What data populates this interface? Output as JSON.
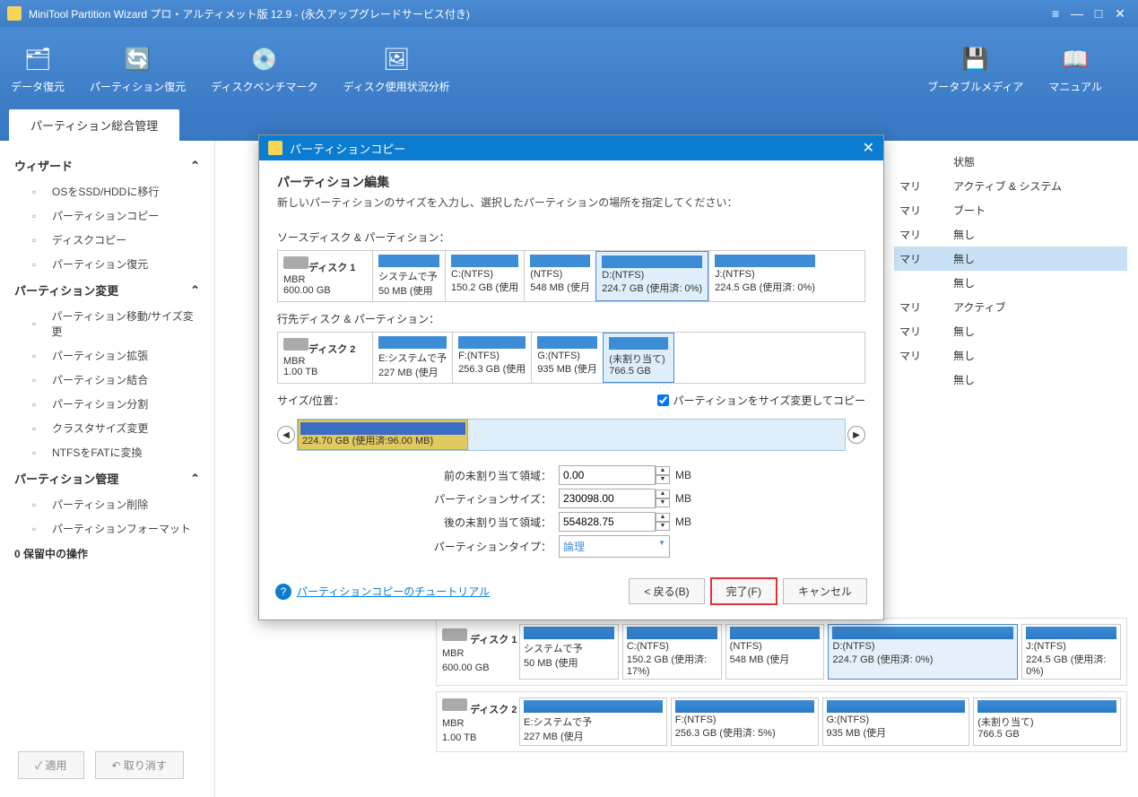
{
  "title": "MiniTool Partition Wizard プロ・アルティメット版 12.9 - (永久アップグレードサービス付き)",
  "ribbon": {
    "items": [
      {
        "label": "データ復元"
      },
      {
        "label": "パーティション復元"
      },
      {
        "label": "ディスクベンチマーク"
      },
      {
        "label": "ディスク使用状況分析"
      }
    ],
    "right": [
      {
        "label": "ブータブルメディア"
      },
      {
        "label": "マニュアル"
      }
    ]
  },
  "tab": "パーティション総合管理",
  "sidebar": {
    "groups": [
      {
        "header": "ウィザード",
        "items": [
          "OSをSSD/HDDに移行",
          "パーティションコピー",
          "ディスクコピー",
          "パーティション復元"
        ]
      },
      {
        "header": "パーティション変更",
        "items": [
          "パーティション移動/サイズ変更",
          "パーティション拡張",
          "パーティション結合",
          "パーティション分割",
          "クラスタサイズ変更",
          "NTFSをFATに変換"
        ]
      },
      {
        "header": "パーティション管理",
        "items": [
          "パーティション削除",
          "パーティションフォーマット"
        ]
      }
    ],
    "pending": "0 保留中の操作",
    "apply": "✓ 適用",
    "undo": "↶ 取り消す"
  },
  "list": {
    "header_status": "状態",
    "rows": [
      {
        "type": "マリ",
        "status": "アクティブ & システム"
      },
      {
        "type": "マリ",
        "status": "ブート"
      },
      {
        "type": "マリ",
        "status": "無し"
      },
      {
        "type": "マリ",
        "status": "無し",
        "sel": true
      },
      {
        "type": "",
        "status": "無し"
      },
      {
        "type": "マリ",
        "status": "アクティブ"
      },
      {
        "type": "マリ",
        "status": "無し"
      },
      {
        "type": "マリ",
        "status": "無し"
      },
      {
        "type": "",
        "status": "無し"
      }
    ]
  },
  "dialog": {
    "title": "パーティションコピー",
    "heading": "パーティション編集",
    "desc": "新しいパーティションのサイズを入力し、選択したパーティションの場所を指定してください：",
    "src_label": "ソースディスク & パーティション：",
    "dst_label": "行先ディスク & パーティション：",
    "disk1": {
      "name": "ディスク 1",
      "type": "MBR",
      "size": "600.00 GB",
      "parts": [
        {
          "name": "システムで予",
          "detail": "50 MB (使用"
        },
        {
          "name": "C:(NTFS)",
          "detail": "150.2 GB (使用"
        },
        {
          "name": "(NTFS)",
          "detail": "548 MB (使月"
        },
        {
          "name": "D:(NTFS)",
          "detail": "224.7 GB (使用済: 0%)",
          "sel": true
        },
        {
          "name": "J:(NTFS)",
          "detail": "224.5 GB (使用済: 0%)"
        }
      ]
    },
    "disk2": {
      "name": "ディスク 2",
      "type": "MBR",
      "size": "1.00 TB",
      "parts": [
        {
          "name": "E:システムで予",
          "detail": "227 MB (使月"
        },
        {
          "name": "F:(NTFS)",
          "detail": "256.3 GB (使用"
        },
        {
          "name": "G:(NTFS)",
          "detail": "935 MB (使月"
        },
        {
          "name": "(未割り当て)",
          "detail": "766.5 GB",
          "sel": true
        }
      ]
    },
    "size_pos": "サイズ/位置：",
    "resize_chk": "パーティションをサイズ変更してコピー",
    "slider_text": "224.70 GB (使用済:96.00 MB)",
    "fields": {
      "before": {
        "label": "前の未割り当て領域：",
        "value": "0.00",
        "unit": "MB"
      },
      "size": {
        "label": "パーティションサイズ：",
        "value": "230098.00",
        "unit": "MB"
      },
      "after": {
        "label": "後の未割り当て領域：",
        "value": "554828.75",
        "unit": "MB"
      },
      "type": {
        "label": "パーティションタイプ：",
        "value": "論理"
      }
    },
    "tutorial": "パーティションコピーのチュートリアル",
    "back": "< 戻る(B)",
    "finish": "完了(F)",
    "cancel": "キャンセル"
  },
  "bottomdisks": {
    "d1": {
      "name": "ディスク 1",
      "type": "MBR",
      "size": "600.00 GB",
      "parts": [
        {
          "name": "システムで予",
          "detail": "50 MB (使用"
        },
        {
          "name": "C:(NTFS)",
          "detail": "150.2 GB (使用済: 17%)"
        },
        {
          "name": "(NTFS)",
          "detail": "548 MB (使月"
        },
        {
          "name": "D:(NTFS)",
          "detail": "224.7 GB (使用済: 0%)",
          "sel": true
        },
        {
          "name": "J:(NTFS)",
          "detail": "224.5 GB (使用済: 0%)"
        }
      ]
    },
    "d2": {
      "name": "ディスク 2",
      "type": "MBR",
      "size": "1.00 TB",
      "parts": [
        {
          "name": "E:システムで予",
          "detail": "227 MB (使月"
        },
        {
          "name": "F:(NTFS)",
          "detail": "256.3 GB (使用済: 5%)"
        },
        {
          "name": "G:(NTFS)",
          "detail": "935 MB (使月"
        },
        {
          "name": "(未割り当て)",
          "detail": "766.5 GB"
        }
      ]
    }
  }
}
